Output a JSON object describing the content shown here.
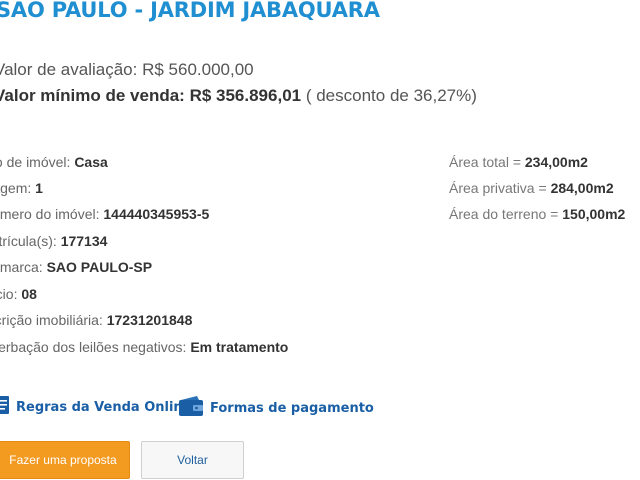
{
  "header": {
    "title": "SAO PAULO - JARDIM JABAQUARA"
  },
  "prices": {
    "avaliacao_label": "Valor de avaliação:",
    "avaliacao_value": "R$ 560.000,00",
    "minimo_label": "Valor mínimo de venda:",
    "minimo_value": "R$ 356.896,01",
    "desconto": "( desconto de 36,27%)"
  },
  "details": [
    {
      "label": "Tipo de imóvel:",
      "value": "Casa"
    },
    {
      "label": "Garagem:",
      "value": "1"
    },
    {
      "label": "Número do imóvel:",
      "value": "144440345953-5"
    },
    {
      "label": "Matrícula(s):",
      "value": "177134"
    },
    {
      "label": "Comarca:",
      "value": "SAO PAULO-SP"
    },
    {
      "label": "Ofício:",
      "value": "08"
    },
    {
      "label": "Inscrição imobiliária:",
      "value": "17231201848"
    },
    {
      "label": "Averbação dos leilões negativos:",
      "value": "Em tratamento"
    }
  ],
  "areas": [
    {
      "label": "Área total =",
      "value": "234,00m2"
    },
    {
      "label": "Área privativa =",
      "value": "284,00m2"
    },
    {
      "label": "Área do terreno =",
      "value": "150,00m2"
    }
  ],
  "links": {
    "regras": "Regras da Venda Online",
    "formas": "Formas de pagamento"
  },
  "buttons": {
    "proposta": "Fazer uma proposta",
    "voltar": "Voltar"
  },
  "colors": {
    "title": "#1f8fd1",
    "link": "#1a5fa5",
    "button_primary": "#f39a21"
  },
  "icons": {
    "regras": "document-check-icon",
    "formas": "wallet-icon"
  }
}
